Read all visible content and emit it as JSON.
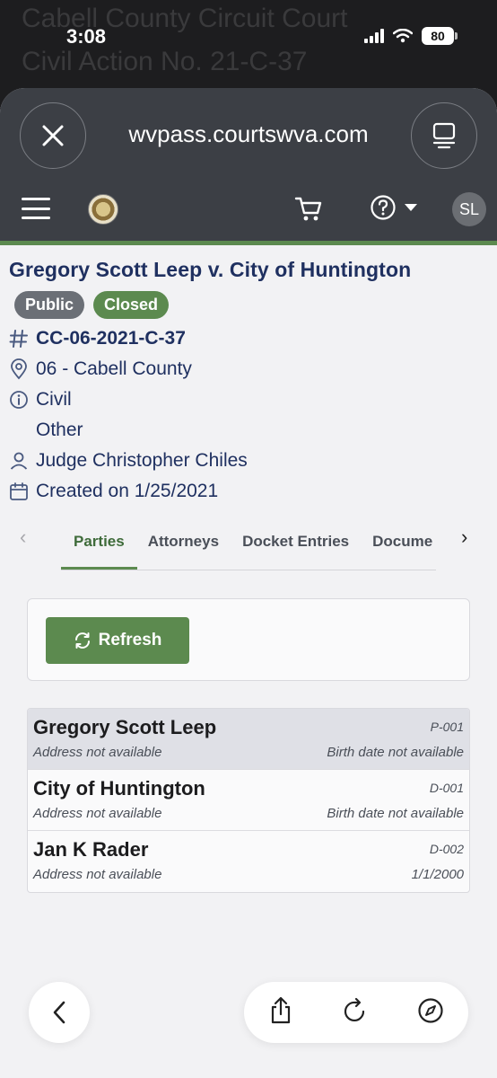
{
  "status_bar": {
    "time": "3:08",
    "battery": "80"
  },
  "background_page": {
    "line1": "Cabell County Circuit Court",
    "line2": "Civil Action No. 21-C-37"
  },
  "browser": {
    "url": "wvpass.courtswva.com"
  },
  "app": {
    "avatar_initials": "SL"
  },
  "case": {
    "title": "Gregory Scott Leep v. City of Huntington",
    "badges": {
      "public": "Public",
      "closed": "Closed"
    },
    "number": "CC-06-2021-C-37",
    "location": "06 - Cabell County",
    "type": "Civil",
    "subtype": "Other",
    "judge": "Judge Christopher Chiles",
    "created": "Created on 1/25/2021"
  },
  "tabs": {
    "parties": "Parties",
    "attorneys": "Attorneys",
    "docket": "Docket Entries",
    "documents": "Docume"
  },
  "refresh_label": "Refresh",
  "parties": [
    {
      "name": "Gregory Scott Leep",
      "code": "P-001",
      "address": "Address not available",
      "birth": "Birth date not available"
    },
    {
      "name": "City of Huntington",
      "code": "D-001",
      "address": "Address not available",
      "birth": "Birth date not available"
    },
    {
      "name": "Jan K Rader",
      "code": "D-002",
      "address": "Address not available",
      "birth": "1/1/2000"
    }
  ],
  "colors": {
    "accent_green": "#5c8a4f",
    "navy": "#1f3060",
    "header_bg": "#3c3f45"
  }
}
